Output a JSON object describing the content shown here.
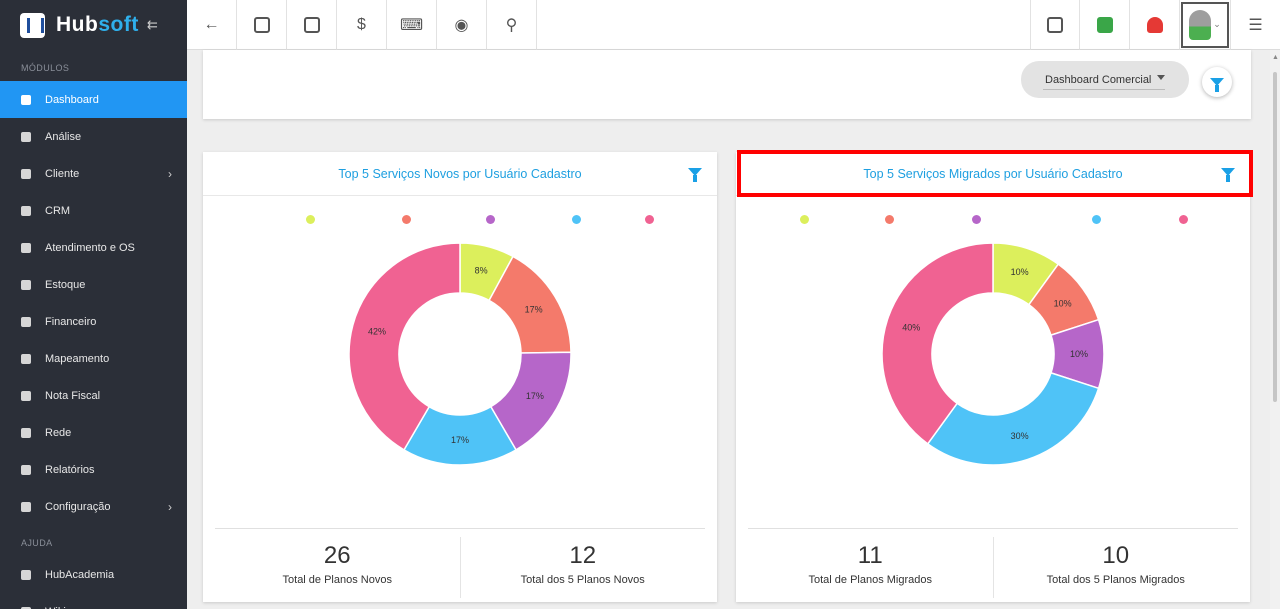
{
  "brand": {
    "name_main": "Hub",
    "name_accent": "soft"
  },
  "sidebar": {
    "section_modules": "MÓDULOS",
    "section_help": "AJUDA",
    "items": [
      {
        "label": "Dashboard",
        "active": true
      },
      {
        "label": "Análise"
      },
      {
        "label": "Cliente",
        "submenu": true
      },
      {
        "label": "CRM"
      },
      {
        "label": "Atendimento e OS"
      },
      {
        "label": "Estoque"
      },
      {
        "label": "Financeiro"
      },
      {
        "label": "Mapeamento"
      },
      {
        "label": "Nota Fiscal"
      },
      {
        "label": "Rede"
      },
      {
        "label": "Relatórios"
      },
      {
        "label": "Configuração",
        "submenu": true
      }
    ],
    "help_items": [
      {
        "label": "HubAcademia"
      },
      {
        "label": "Wiki"
      }
    ]
  },
  "topbar": {
    "left_icons": [
      "back-arrow-icon",
      "contact-card-icon",
      "calendar-clock-icon",
      "dollar-icon",
      "terminal-icon",
      "eye-icon",
      "search-icon"
    ],
    "right_icons": [
      "pdf-icon",
      "chat-check-icon",
      "alarm-bell-icon",
      "user-avatar-icon",
      "list-menu-icon"
    ]
  },
  "filter_bar": {
    "dashboard_select": "Dashboard Comercial"
  },
  "colors": {
    "accent": "#1e9fe0",
    "sidebar": "#2b2f38",
    "active": "#2196f3",
    "highlight": "#ff0000"
  },
  "cards": [
    {
      "title": "Top 5 Serviços Novos por Usuário Cadastro",
      "stats": [
        {
          "value": "26",
          "label": "Total de Planos Novos"
        },
        {
          "value": "12",
          "label": "Total dos 5 Planos Novos"
        }
      ]
    },
    {
      "title": "Top 5 Serviços Migrados por Usuário Cadastro",
      "stats": [
        {
          "value": "11",
          "label": "Total de Planos Migrados"
        },
        {
          "value": "10",
          "label": "Total dos 5 Planos Migrados"
        }
      ]
    }
  ],
  "chart_data": [
    {
      "type": "pie",
      "title": "Top 5 Serviços Novos por Usuário Cadastro",
      "categories": [
        "",
        "",
        "",
        "",
        ""
      ],
      "values": [
        8,
        17,
        17,
        17,
        42
      ],
      "labels": [
        "8%",
        "17%",
        "17%",
        "17%",
        "42%"
      ],
      "colors": [
        "#dcef5c",
        "#f47a6b",
        "#b666c9",
        "#4fc3f7",
        "#f06292"
      ]
    },
    {
      "type": "pie",
      "title": "Top 5 Serviços Migrados por Usuário Cadastro",
      "categories": [
        "",
        "",
        "",
        "",
        ""
      ],
      "values": [
        10,
        10,
        10,
        30,
        40
      ],
      "labels": [
        "10%",
        "10%",
        "10%",
        "30%",
        "40%"
      ],
      "colors": [
        "#dcef5c",
        "#f47a6b",
        "#b666c9",
        "#4fc3f7",
        "#f06292"
      ]
    }
  ]
}
